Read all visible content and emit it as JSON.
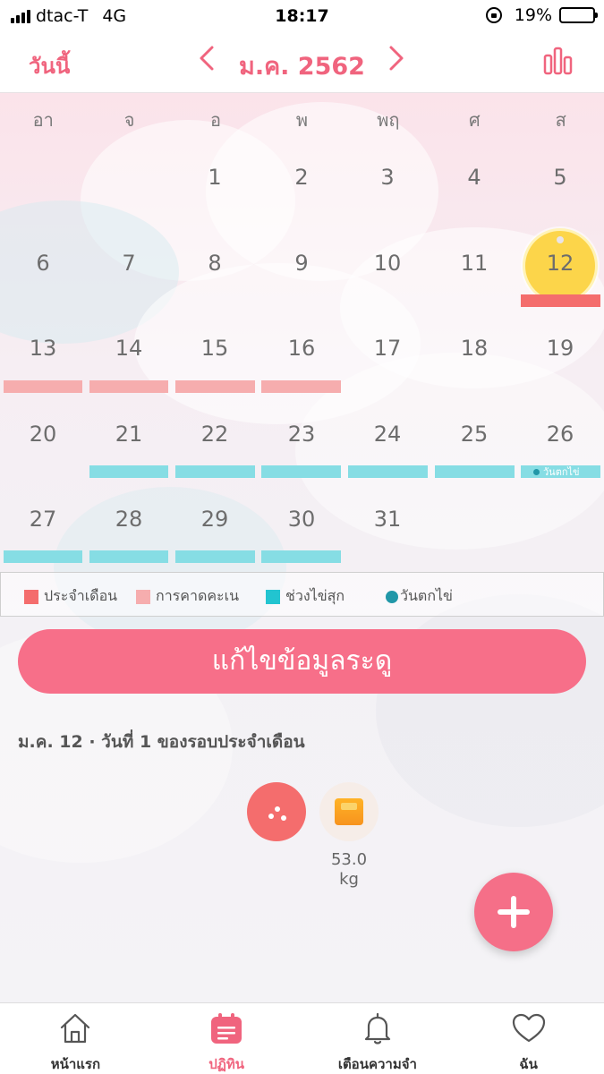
{
  "status_bar": {
    "carrier": "dtac-T",
    "network": "4G",
    "time": "18:17",
    "battery": "19%",
    "battery_level": 0.19
  },
  "header": {
    "today_label": "วันนี้",
    "month_label": "ม.ค. 2562",
    "prev_icon": "chevron-left-icon",
    "next_icon": "chevron-right-icon",
    "stats_icon": "bar-chart-icon"
  },
  "calendar": {
    "weekdays": [
      "อา",
      "จ",
      "อ",
      "พ",
      "พฤ",
      "ศ",
      "ส"
    ],
    "days": [
      "1",
      "2",
      "3",
      "4",
      "5",
      "6",
      "7",
      "8",
      "9",
      "10",
      "11",
      "12",
      "13",
      "14",
      "15",
      "16",
      "17",
      "18",
      "19",
      "20",
      "21",
      "22",
      "23",
      "24",
      "25",
      "26",
      "27",
      "28",
      "29",
      "30",
      "31"
    ],
    "today": "12",
    "ovulation_label": "วันตกไข่"
  },
  "legend": {
    "period": "ประจำเดือน",
    "prediction": "การคาดคะเน",
    "fertile": "ช่วงไข่สุก",
    "ovulation": "วันตกไข่"
  },
  "colors": {
    "accent": "#f0647e",
    "period": "#f46d6d",
    "prediction": "#f6adae",
    "fertile": "#86dde4",
    "ovulation": "#2197a8",
    "today": "#fcd54a"
  },
  "edit_button": "แก้ไขข้อมูลระดู",
  "cycle_info": "ม.ค. 12 · วันที่ 1 ของรอบประจำเดือน",
  "records": {
    "mood_icon": "mood-dots-icon",
    "weight_icon": "scale-icon",
    "weight_value": "53.0",
    "weight_unit": "kg"
  },
  "fab_icon": "plus-icon",
  "tabs": [
    {
      "label": "หน้าแรก",
      "icon": "home-icon"
    },
    {
      "label": "ปฏิทิน",
      "icon": "calendar-icon"
    },
    {
      "label": "เตือนความจำ",
      "icon": "bell-icon"
    },
    {
      "label": "ฉัน",
      "icon": "heart-icon"
    }
  ]
}
